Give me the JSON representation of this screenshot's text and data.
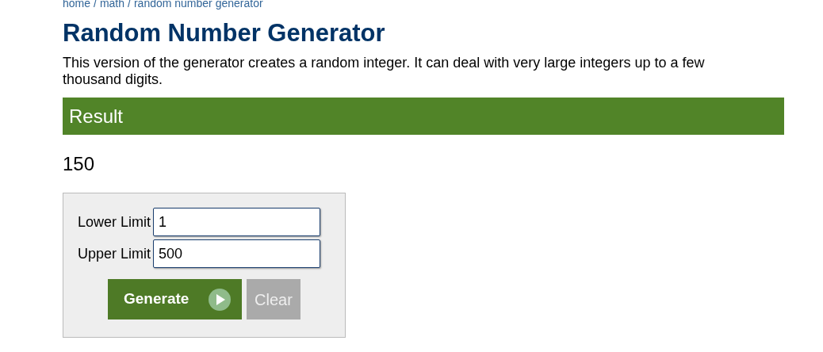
{
  "breadcrumb": {
    "separator": "/",
    "links": [
      "home",
      "math",
      "random number generator"
    ]
  },
  "title": "Random Number Generator",
  "description": "This version of the generator creates a random integer. It can deal with very large integers up to a few thousand digits.",
  "result": {
    "heading": "Result",
    "value": "150"
  },
  "form": {
    "fields": [
      {
        "label": "Lower Limit",
        "value": "1"
      },
      {
        "label": "Upper Limit",
        "value": "500"
      }
    ],
    "buttons": [
      {
        "label": "Generate",
        "kind": "primary"
      },
      {
        "label": "Clear",
        "kind": "secondary"
      }
    ]
  }
}
